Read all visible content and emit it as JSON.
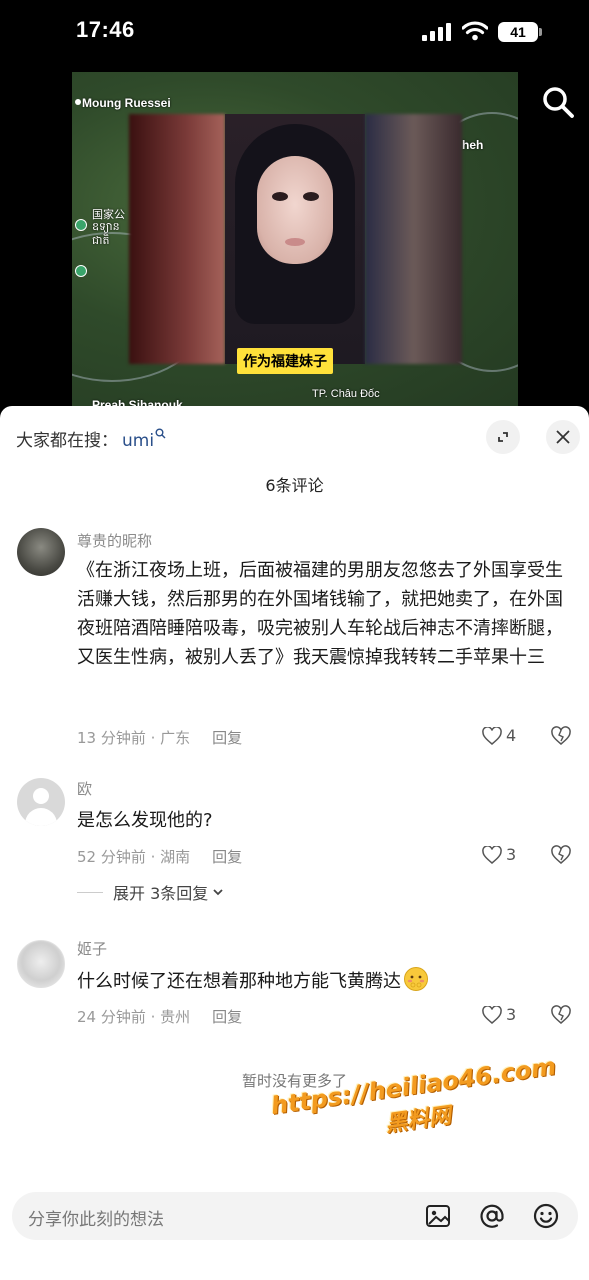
{
  "status_bar": {
    "time": "17:46",
    "battery": "41"
  },
  "video": {
    "caption": "作为福建妹子",
    "map_labels": [
      "Moung Ruessei",
      "国家公",
      "ឧទ្យាន",
      "ជាតិ",
      "heh",
      "Preah Sihanouk",
      "TP. Châu Đốc"
    ]
  },
  "sheet": {
    "search_prefix": "大家都在搜：",
    "search_term": "umi",
    "comments_title": "6条评论",
    "reply_label": "回复",
    "expand_replies": "展开 3条回复",
    "no_more": "暂时没有更多了",
    "input_placeholder": "分享你此刻的想法"
  },
  "comments": [
    {
      "username": "尊贵的昵称",
      "text": "《在浙江夜场上班，后面被福建的男朋友忽悠去了外国享受生活赚大钱，然后那男的在外国堵钱输了，就把她卖了，在外国夜班陪酒陪睡陪吸毒，吸完被别人车轮战后神志不清摔断腿，又医生性病，被别人丢了》我天震惊掉我转转二手苹果十三",
      "meta": "13 分钟前 · 广东",
      "likes": "4"
    },
    {
      "username": "欧",
      "text": "是怎么发现他的?",
      "meta": "52 分钟前 · 湖南",
      "likes": "3"
    },
    {
      "username": "姬子",
      "text": "什么时候了还在想着那种地方能飞黄腾达",
      "meta": "24 分钟前 · 贵州",
      "likes": "3"
    }
  ],
  "watermark": {
    "line1": "https://heiliao46.com",
    "line2": "黑料网"
  },
  "colors": {
    "caption_bg": "#ffe13a",
    "search_term": "#2a4f8a",
    "watermark": "#f39b1f"
  }
}
